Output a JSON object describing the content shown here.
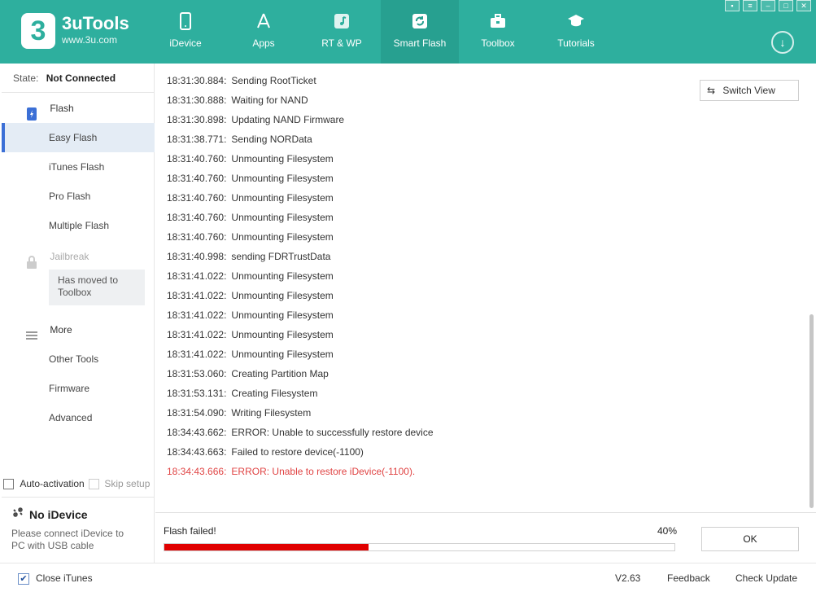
{
  "app": {
    "brand_name": "3uTools",
    "brand_url": "www.3u.com",
    "logo_text": "3"
  },
  "nav": [
    {
      "label": "iDevice",
      "icon": "phone-icon"
    },
    {
      "label": "Apps",
      "icon": "apps-icon"
    },
    {
      "label": "RT & WP",
      "icon": "music-icon"
    },
    {
      "label": "Smart Flash",
      "icon": "refresh-icon",
      "active": true
    },
    {
      "label": "Toolbox",
      "icon": "toolbox-icon"
    },
    {
      "label": "Tutorials",
      "icon": "graduation-cap-icon"
    }
  ],
  "sidebar": {
    "state_label": "State:",
    "state_value": "Not Connected",
    "flash_label": "Flash",
    "items": [
      "Easy Flash",
      "iTunes Flash",
      "Pro Flash",
      "Multiple Flash"
    ],
    "jailbreak_label": "Jailbreak",
    "moved_line1": "Has moved to",
    "moved_line2": "Toolbox",
    "more_label": "More",
    "more_items": [
      "Other Tools",
      "Firmware",
      "Advanced"
    ],
    "auto_activation": "Auto-activation",
    "skip_setup": "Skip setup",
    "no_device_title": "No iDevice",
    "no_device_desc": "Please connect iDevice to PC with USB cable"
  },
  "main": {
    "switch_view": "Switch View",
    "log": [
      {
        "time": "18:31:30.884:",
        "msg": "Sending RootTicket"
      },
      {
        "time": "18:31:30.888:",
        "msg": "Waiting for NAND"
      },
      {
        "time": "18:31:30.898:",
        "msg": "Updating NAND Firmware"
      },
      {
        "time": "18:31:38.771:",
        "msg": "Sending NORData"
      },
      {
        "time": "18:31:40.760:",
        "msg": "Unmounting Filesystem"
      },
      {
        "time": "18:31:40.760:",
        "msg": "Unmounting Filesystem"
      },
      {
        "time": "18:31:40.760:",
        "msg": "Unmounting Filesystem"
      },
      {
        "time": "18:31:40.760:",
        "msg": "Unmounting Filesystem"
      },
      {
        "time": "18:31:40.760:",
        "msg": "Unmounting Filesystem"
      },
      {
        "time": "18:31:40.998:",
        "msg": "sending FDRTrustData"
      },
      {
        "time": "18:31:41.022:",
        "msg": "Unmounting Filesystem"
      },
      {
        "time": "18:31:41.022:",
        "msg": "Unmounting Filesystem"
      },
      {
        "time": "18:31:41.022:",
        "msg": "Unmounting Filesystem"
      },
      {
        "time": "18:31:41.022:",
        "msg": "Unmounting Filesystem"
      },
      {
        "time": "18:31:41.022:",
        "msg": "Unmounting Filesystem"
      },
      {
        "time": "18:31:53.060:",
        "msg": "Creating Partition Map"
      },
      {
        "time": "18:31:53.131:",
        "msg": "Creating Filesystem"
      },
      {
        "time": "18:31:54.090:",
        "msg": "Writing Filesystem"
      },
      {
        "time": "18:34:43.662:",
        "msg": "ERROR: Unable to successfully restore device"
      },
      {
        "time": "18:34:43.663:",
        "msg": "Failed to restore device(-1100)"
      },
      {
        "time": "18:34:43.666:",
        "msg": "ERROR: Unable to restore iDevice(-1100).",
        "error": true
      }
    ]
  },
  "progress": {
    "status": "Flash failed!",
    "percent_label": "40%",
    "percent": 40,
    "ok_label": "OK",
    "fill_color": "#e00000"
  },
  "footer": {
    "close_itunes": "Close iTunes",
    "version": "V2.63",
    "feedback": "Feedback",
    "check_update": "Check Update"
  },
  "colors": {
    "header": "#2eaf9e",
    "active_nav": "#27a090",
    "error_text": "#e04444",
    "sidebar_active": "#e4ecf5",
    "sidebar_active_border": "#3b6fd6"
  }
}
